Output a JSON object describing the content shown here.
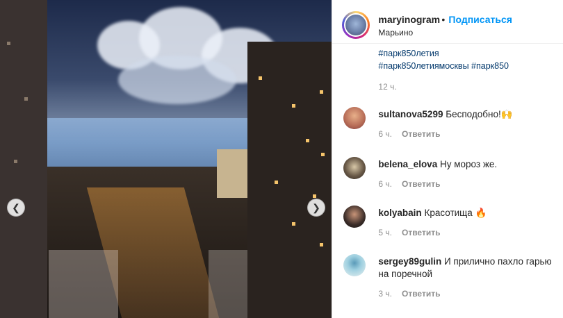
{
  "post": {
    "username": "maryinogram",
    "separator": "•",
    "follow_label": "Подписаться",
    "location": "Марьино",
    "more_icon": "more-horizontal-icon"
  },
  "caption": {
    "tags_line1": "#парк850летия",
    "tags_line2_a": "#парк850летиямосквы",
    "tags_line2_b": "#парк850",
    "time": "12 ч."
  },
  "comments": [
    {
      "user": "sultanova5299",
      "text": "Бесподобно!🙌",
      "time": "6 ч.",
      "reply": "Ответить"
    },
    {
      "user": "belena_elova",
      "text": "Ну мороз же.",
      "time": "6 ч.",
      "reply": "Ответить"
    },
    {
      "user": "kolyabain",
      "text": "Красотища 🔥",
      "time": "5 ч.",
      "reply": "Ответить"
    },
    {
      "user": "sergey89gulin",
      "text": "И прилично пахло гарью на поречной",
      "time": "3 ч.",
      "reply": "Ответить"
    }
  ],
  "carousel": {
    "prev_icon": "chevron-left-icon",
    "next_icon": "chevron-right-icon",
    "prev_glyph": "❮",
    "next_glyph": "❯"
  }
}
